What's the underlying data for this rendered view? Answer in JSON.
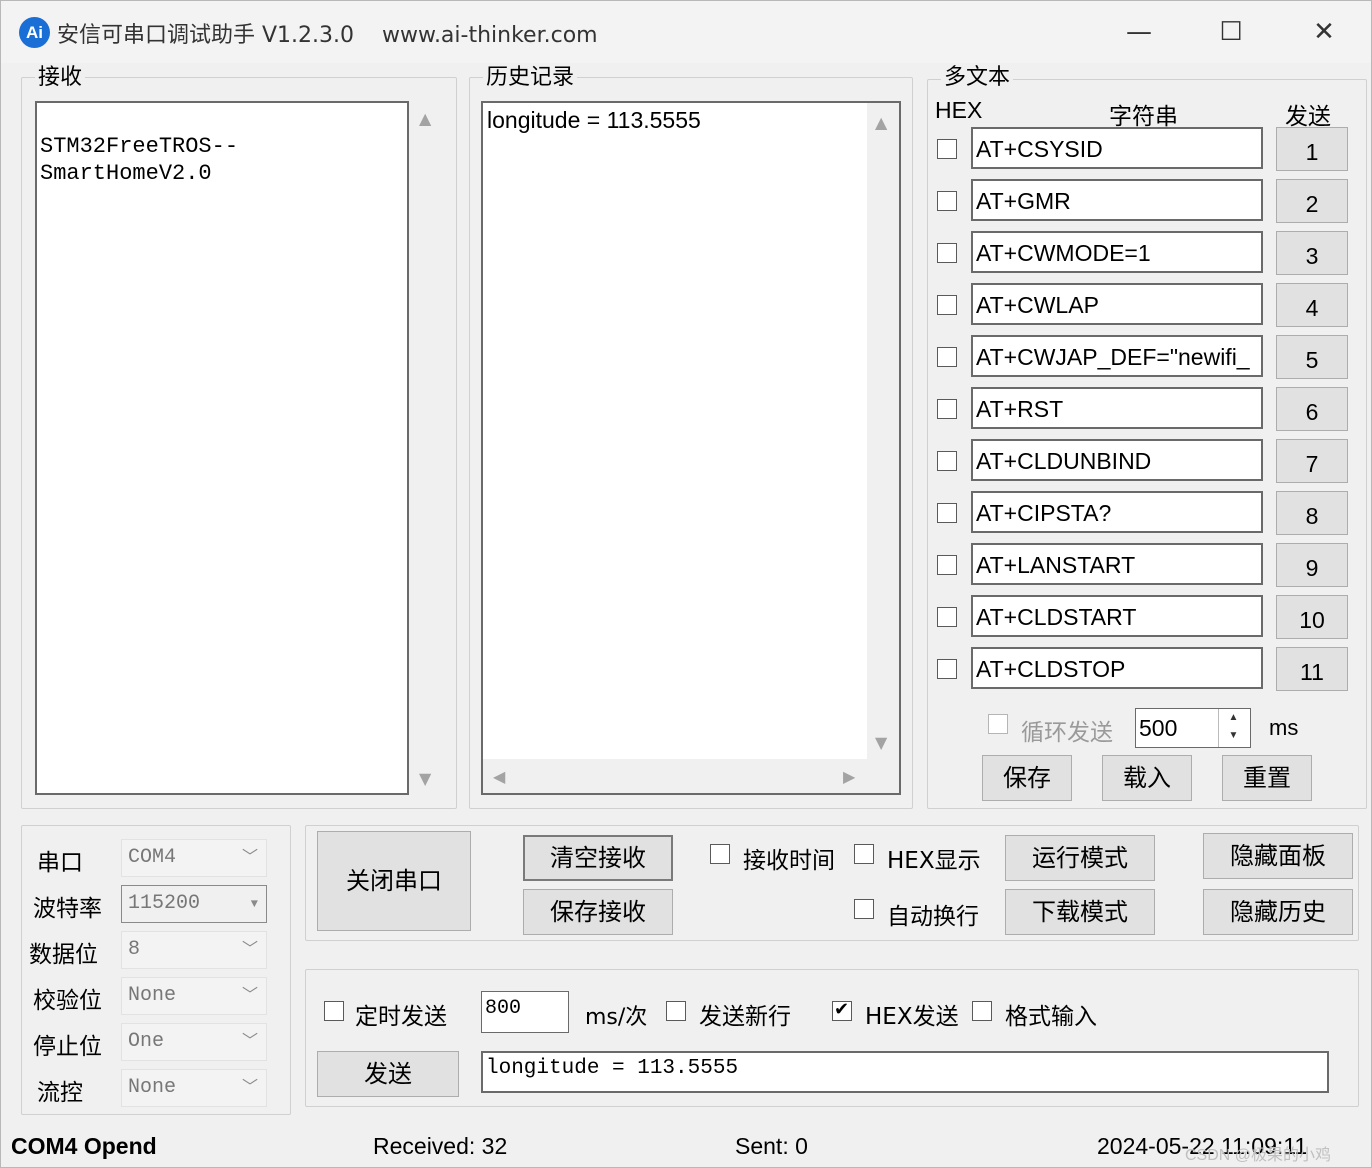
{
  "titlebar": {
    "icon_text": "Ai",
    "title": "安信可串口调试助手 V1.2.3.0    www.ai-thinker.com",
    "minimize": "—",
    "maximize": "☐",
    "close": "✕"
  },
  "receive": {
    "label": "接收",
    "lines": [
      "STM32FreeTROS--",
      "SmartHomeV2.0"
    ]
  },
  "history": {
    "label": "历史记录",
    "content": "longitude = 113.5555"
  },
  "multitext": {
    "label": "多文本",
    "hex_header": "HEX",
    "string_header": "字符串",
    "send_header": "发送",
    "rows": [
      {
        "text": "AT+CSYSID",
        "button": "1"
      },
      {
        "text": "AT+GMR",
        "button": "2"
      },
      {
        "text": "AT+CWMODE=1",
        "button": "3"
      },
      {
        "text": "AT+CWLAP",
        "button": "4"
      },
      {
        "text": "AT+CWJAP_DEF=\"newifi_",
        "button": "5"
      },
      {
        "text": "AT+RST",
        "button": "6"
      },
      {
        "text": "AT+CLDUNBIND",
        "button": "7"
      },
      {
        "text": "AT+CIPSTA?",
        "button": "8"
      },
      {
        "text": "AT+LANSTART",
        "button": "9"
      },
      {
        "text": "AT+CLDSTART",
        "button": "10"
      },
      {
        "text": "AT+CLDSTOP",
        "button": "11"
      }
    ],
    "loop_send_label": "循环发送",
    "loop_interval": "500",
    "loop_unit": "ms",
    "save": "保存",
    "load": "载入",
    "reset": "重置"
  },
  "port_settings": {
    "port_label": "串口",
    "port_value": "COM4",
    "baud_label": "波特率",
    "baud_value": "115200",
    "databits_label": "数据位",
    "databits_value": "8",
    "parity_label": "校验位",
    "parity_value": "None",
    "stopbits_label": "停止位",
    "stopbits_value": "One",
    "flow_label": "流控",
    "flow_value": "None"
  },
  "controls": {
    "close_port": "关闭串口",
    "clear_receive": "清空接收",
    "save_receive": "保存接收",
    "receive_time": "接收时间",
    "hex_display": "HEX显示",
    "auto_wrap": "自动换行",
    "run_mode": "运行模式",
    "download_mode": "下载模式",
    "hide_panel": "隐藏面板",
    "hide_history": "隐藏历史"
  },
  "send": {
    "timed_send": "定时发送",
    "interval": "800",
    "interval_unit": "ms/次",
    "send_newline": "发送新行",
    "hex_send": "HEX发送",
    "hex_send_checked": true,
    "format_input": "格式输入",
    "send_button": "发送",
    "send_text": "longitude = 113.5555"
  },
  "status": {
    "port_state": "COM4 Opend",
    "received": "Received: 32",
    "sent": "Sent: 0",
    "datetime": "2024-05-22 11:09:11",
    "watermark": "CSDN @极果的小鸡"
  }
}
